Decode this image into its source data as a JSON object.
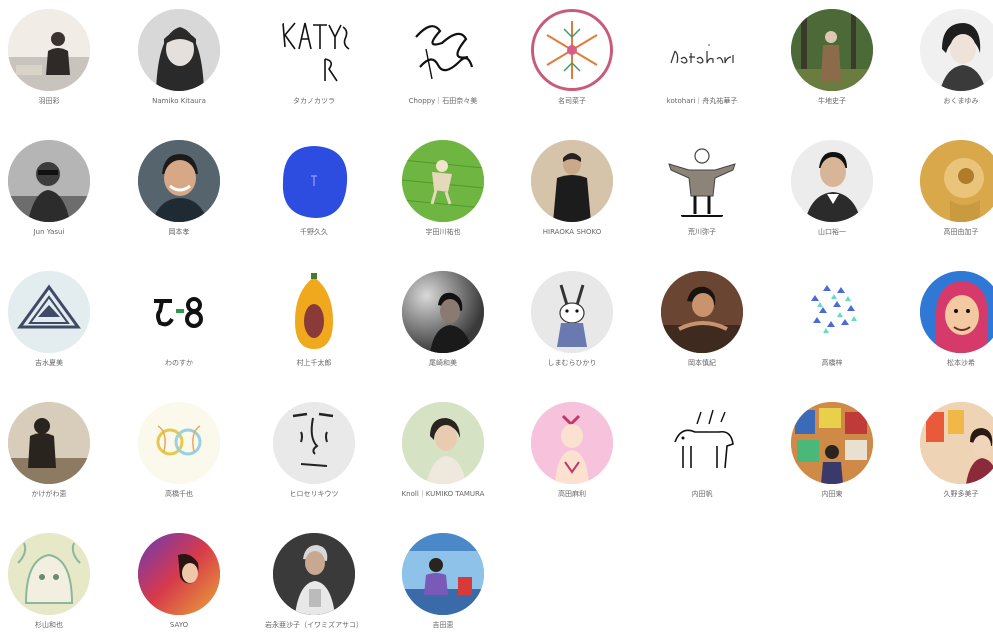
{
  "artists": [
    {
      "name": "羽田彩",
      "icon": "photo-icon",
      "bg": "#e9e3dc"
    },
    {
      "name": "Namiko Kitaura",
      "icon": "photo-icon",
      "bg": "#cfcfcf"
    },
    {
      "name": "タカノカツラ",
      "icon": "logo-icon",
      "bg": "#ffffff"
    },
    {
      "name": "Choppy｜石田奈々美",
      "icon": "logo-icon",
      "bg": "#ffffff"
    },
    {
      "name": "名司菜子",
      "icon": "snowflake-icon",
      "bg": "#ffffff"
    },
    {
      "name": "kotohari｜舟丸祐華子",
      "icon": "logo-icon",
      "bg": "#ffffff"
    },
    {
      "name": "牛地史子",
      "icon": "photo-icon",
      "bg": "#5d7a45"
    },
    {
      "name": "おくまゆみ",
      "icon": "photo-icon",
      "bg": "#f2f2f2"
    },
    {
      "name": "Jun Yasui",
      "icon": "photo-icon",
      "bg": "#9c9c9c"
    },
    {
      "name": "岡本孝",
      "icon": "photo-icon",
      "bg": "#49555e"
    },
    {
      "name": "千野久久",
      "icon": "illustration-icon",
      "bg": "#2d4de0"
    },
    {
      "name": "宇田川祐也",
      "icon": "photo-icon",
      "bg": "#6fb541"
    },
    {
      "name": "HIRAOKA SHOKO",
      "icon": "photo-icon",
      "bg": "#cdb89c"
    },
    {
      "name": "荒川弥子",
      "icon": "illustration-icon",
      "bg": "#ffffff"
    },
    {
      "name": "山口裕一",
      "icon": "photo-icon",
      "bg": "#e9e9e9"
    },
    {
      "name": "高田由加子",
      "icon": "illustration-icon",
      "bg": "#d9a84b"
    },
    {
      "name": "吉水夏美",
      "icon": "illustration-icon",
      "bg": "#dfe8ea"
    },
    {
      "name": "わのすか",
      "icon": "logo-icon",
      "bg": "#ffffff"
    },
    {
      "name": "村上千太郎",
      "icon": "papaya-icon",
      "bg": "#ffffff"
    },
    {
      "name": "尾崎和美",
      "icon": "photo-icon",
      "bg": "#6e6e6e"
    },
    {
      "name": "しまむらひかり",
      "icon": "illustration-icon",
      "bg": "#e5e5e5"
    },
    {
      "name": "岡本慎紀",
      "icon": "photo-icon",
      "bg": "#5a3a2a"
    },
    {
      "name": "高橋梓",
      "icon": "illustration-icon",
      "bg": "#ffffff"
    },
    {
      "name": "松本沙希",
      "icon": "illustration-icon",
      "bg": "#2f78d6"
    },
    {
      "name": "かけがわ恵",
      "icon": "photo-icon",
      "bg": "#cfc4b3"
    },
    {
      "name": "高橋千也",
      "icon": "illustration-icon",
      "bg": "#f7f2e1"
    },
    {
      "name": "ヒロセリキウツ",
      "icon": "illustration-icon",
      "bg": "#ededed"
    },
    {
      "name": "Knoll｜KUMIKO TAMURA",
      "icon": "photo-icon",
      "bg": "#c9d7b8"
    },
    {
      "name": "高田麻利",
      "icon": "illustration-icon",
      "bg": "#f6bfd9"
    },
    {
      "name": "内田帆",
      "icon": "illustration-icon",
      "bg": "#ffffff"
    },
    {
      "name": "内田東",
      "icon": "photo-icon",
      "bg": "#c87f3a"
    },
    {
      "name": "久野多美子",
      "icon": "photo-icon",
      "bg": "#e8c8a8"
    },
    {
      "name": "杉山和也",
      "icon": "illustration-icon",
      "bg": "#e8e6cc"
    },
    {
      "name": "SAYO",
      "icon": "photo-icon",
      "bg": "#c23a52"
    },
    {
      "name": "岩永亜沙子（イワミズアサコ）",
      "icon": "photo-icon",
      "bg": "#2b2b2b"
    },
    {
      "name": "吉田恵",
      "icon": "photo-icon",
      "bg": "#5aa0d8"
    }
  ]
}
